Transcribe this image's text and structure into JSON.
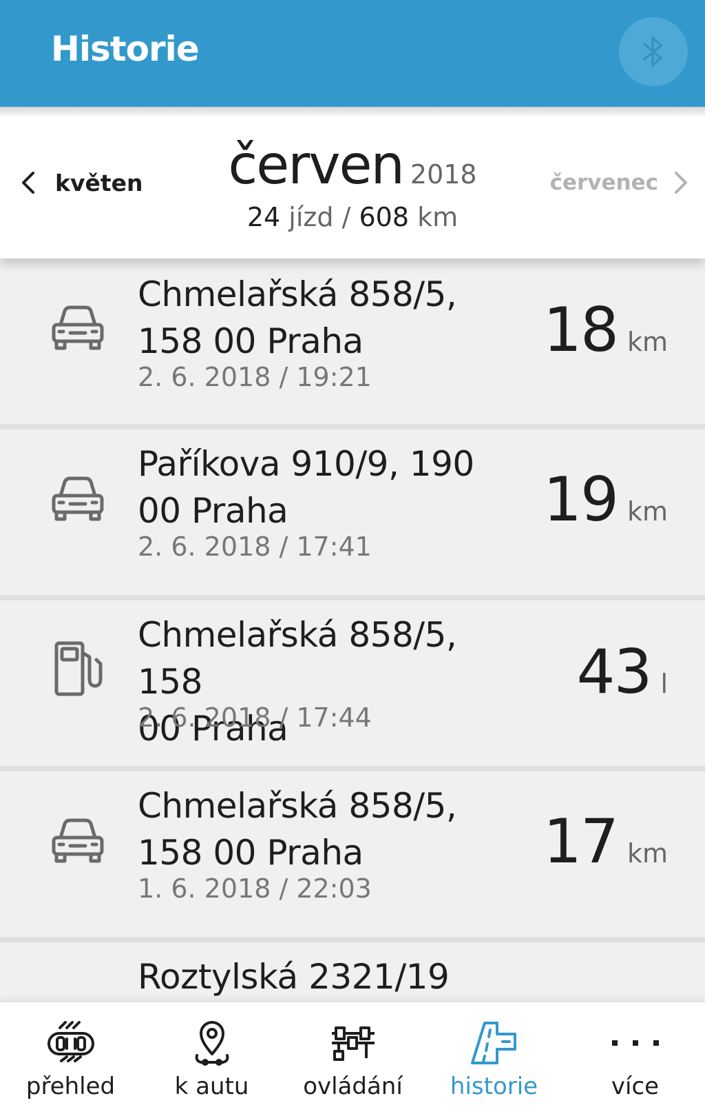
{
  "header": {
    "title": "Historie",
    "bluetooth_icon": "bluetooth-icon"
  },
  "month": {
    "prev_label": "květen",
    "next_label": "červenec",
    "name": "červen",
    "year": "2018",
    "trips_count": "24",
    "trips_unit": "jízd",
    "separator": "/",
    "distance": "608",
    "distance_unit": "km"
  },
  "trips": [
    {
      "type": "drive",
      "icon": "car-icon",
      "address_line1": "Chmelařská 858/5,",
      "address_line2": "158 00 Praha",
      "datetime": "2. 6. 2018 / 19:21",
      "value": "18",
      "unit": "km"
    },
    {
      "type": "drive",
      "icon": "car-icon",
      "address_line1": "Paříkova 910/9, 190",
      "address_line2": "00 Praha",
      "datetime": "2. 6. 2018 / 17:41",
      "value": "19",
      "unit": "km"
    },
    {
      "type": "refuel",
      "icon": "fuel-pump-icon",
      "address_line1": "Chmelařská 858/5, 158",
      "address_line2": "00 Praha",
      "datetime": "2. 6. 2018 / 17:44",
      "value": "43",
      "unit": "l"
    },
    {
      "type": "drive",
      "icon": "car-icon",
      "address_line1": "Chmelařská 858/5,",
      "address_line2": "158 00 Praha",
      "datetime": "1. 6. 2018 / 22:03",
      "value": "17",
      "unit": "km"
    },
    {
      "type": "drive",
      "icon": "car-icon",
      "address_line1": "Roztylská 2321/19",
      "address_line2": "",
      "datetime": "",
      "value": "",
      "unit": ""
    }
  ],
  "bottom_nav": [
    {
      "label": "přehled",
      "icon": "car-overview-icon",
      "active": false
    },
    {
      "label": "k autu",
      "icon": "map-pin-icon",
      "active": false
    },
    {
      "label": "ovládání",
      "icon": "controls-icon",
      "active": false
    },
    {
      "label": "historie",
      "icon": "road-icon",
      "active": true
    },
    {
      "label": "více",
      "icon": "more-icon",
      "active": false
    }
  ],
  "colors": {
    "accent": "#3399cc",
    "header_bg": "#3399cc",
    "list_bg": "#f0f0f0",
    "text": "#1e1e1e",
    "muted": "#777777"
  }
}
